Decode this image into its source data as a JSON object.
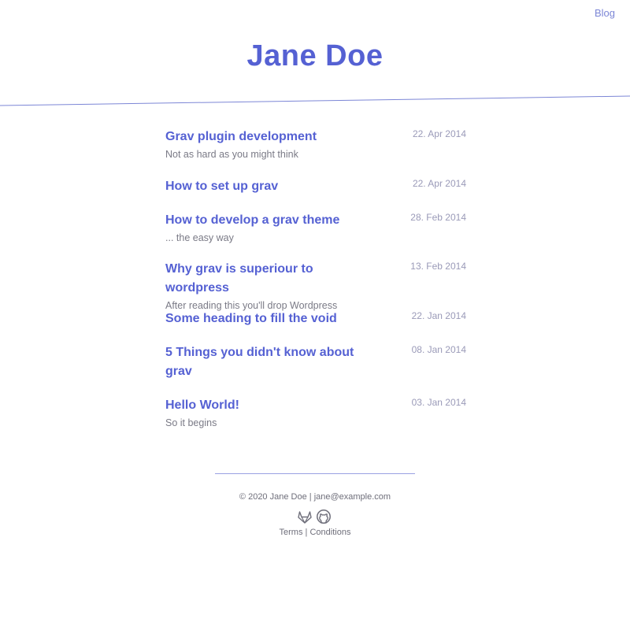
{
  "nav": {
    "blog_label": "Blog"
  },
  "site": {
    "title": "Jane Doe"
  },
  "posts": [
    {
      "title": "Grav plugin development",
      "subtitle": "Not as hard as you might think",
      "date": "22. Apr 2014"
    },
    {
      "title": "How to set up grav",
      "subtitle": "",
      "date": "22. Apr 2014"
    },
    {
      "title": "How to develop a grav theme",
      "subtitle": "... the easy way",
      "date": "28. Feb 2014"
    },
    {
      "title": "Why grav is superiour to wordpress",
      "subtitle": "After reading this you'll drop Wordpress",
      "date": "13. Feb 2014"
    },
    {
      "title": "Some heading to fill the void",
      "subtitle": "",
      "date": "22. Jan 2014"
    },
    {
      "title": "5 Things you didn't know about grav",
      "subtitle": "",
      "date": "08. Jan 2014"
    },
    {
      "title": "Hello World!",
      "subtitle": "So it begins",
      "date": "03. Jan 2014"
    }
  ],
  "footer": {
    "copyright": "© 2020 Jane Doe",
    "separator": "|",
    "email": "jane@example.com",
    "terms_label": "Terms",
    "conditions_label": "Conditions",
    "icons": [
      "gitlab-icon",
      "github-icon"
    ]
  },
  "colors": {
    "accent": "#5561d3",
    "muted": "#9a9ab8",
    "text": "#7a7a86"
  }
}
